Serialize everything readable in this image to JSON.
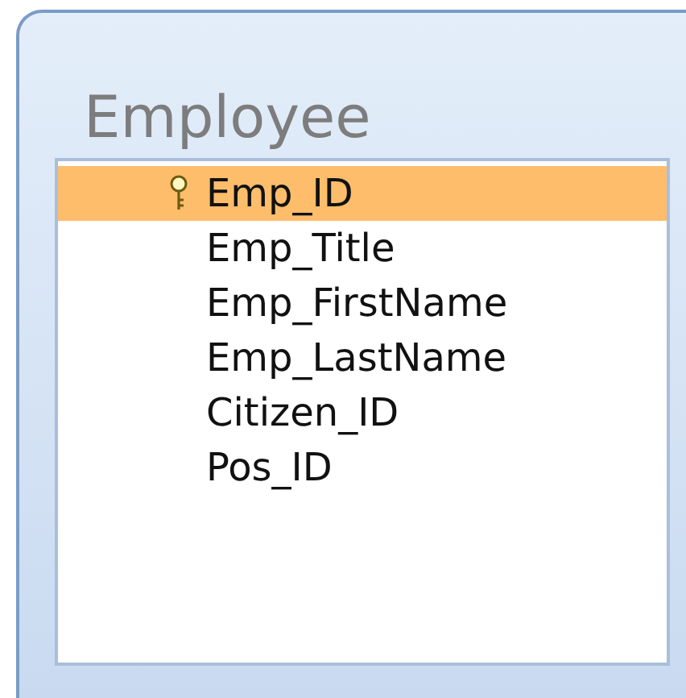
{
  "table": {
    "title": "Employee",
    "fields": [
      {
        "name": "Emp_ID",
        "primary_key": true,
        "selected": true
      },
      {
        "name": "Emp_Title",
        "primary_key": false,
        "selected": false
      },
      {
        "name": "Emp_FirstName",
        "primary_key": false,
        "selected": false
      },
      {
        "name": "Emp_LastName",
        "primary_key": false,
        "selected": false
      },
      {
        "name": "Citizen_ID",
        "primary_key": false,
        "selected": false
      },
      {
        "name": "Pos_ID",
        "primary_key": false,
        "selected": false
      }
    ]
  }
}
